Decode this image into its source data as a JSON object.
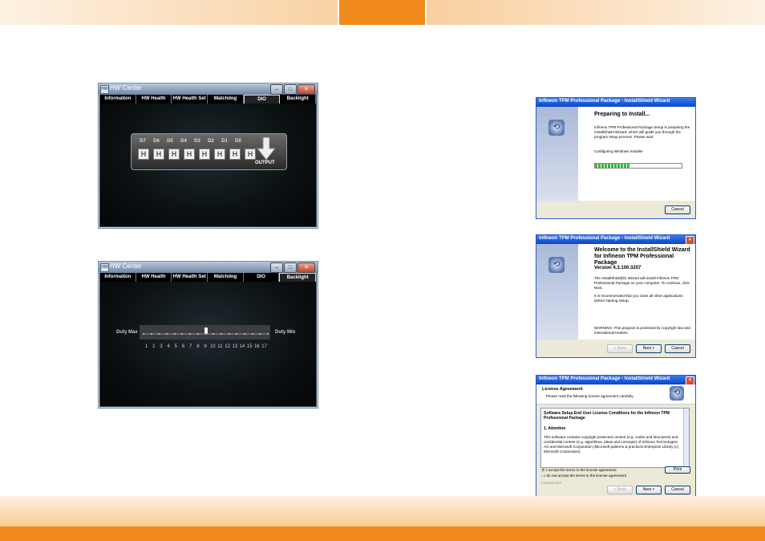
{
  "hw_windows": [
    {
      "title": "HW Center",
      "menu": [
        "Information",
        "HW Health",
        "HW Health Set",
        "Watchdog",
        "DIO",
        "Backlight"
      ],
      "active_tab": "DIO",
      "dio": {
        "labels": [
          "D7",
          "D6",
          "D5",
          "D4",
          "D3",
          "D2",
          "D1",
          "D0"
        ],
        "states": [
          "H",
          "H",
          "H",
          "H",
          "H",
          "H",
          "H",
          "H"
        ],
        "output_label": "OUTPUT"
      }
    },
    {
      "title": "HW Center",
      "menu": [
        "Information",
        "HW Health",
        "HW Health Set",
        "Watchdog",
        "DIO",
        "Backlight"
      ],
      "active_tab": "Backlight",
      "backlight": {
        "left_label": "Duty Max",
        "right_label": "Duty Min",
        "ticks": [
          "1",
          "2",
          "3",
          "4",
          "5",
          "6",
          "7",
          "8",
          "9",
          "10",
          "11",
          "12",
          "13",
          "14",
          "15",
          "16",
          "17"
        ],
        "value": 9
      }
    }
  ],
  "installer": {
    "title": "Infineon TPM Professional Package - InstallShield Wizard",
    "preparing": {
      "heading": "Preparing to Install...",
      "text": "Infineon TPM Professional Package Setup is preparing the InstallShield Wizard, which will guide you through the program setup process. Please wait.",
      "status": "Configuring Windows Installer",
      "progress": 0.4,
      "cancel": "Cancel"
    },
    "welcome": {
      "heading": "Welcome to the InstallShield Wizard for Infineon TPM Professional Package",
      "version": "Version 4.3.100.3207",
      "text1": "The InstallShield(R) Wizard will install Infineon TPM Professional Package on your computer. To continue, click Next.",
      "text2": "It is recommended that you close all other applications before starting Setup.",
      "warning": "WARNING: This program is protected by copyright law and international treaties.",
      "back": "< Back",
      "next": "Next >",
      "cancel": "Cancel"
    },
    "license": {
      "heading": "License Agreement",
      "subheading": "Please read the following license agreement carefully.",
      "doc_title": "Software Setup End User License Conditions for the Infineon TPM Professional Package",
      "section": "1. Attention",
      "body": "This software contains copyright protected content (e.g. codes and structures) and confidential content (e.g. algorithms, ideas and concepts) of Infineon Technologies AG and Microsoft Corporation (Microsoft patterns & practices Enterprise Library (c) Microsoft Corporation).",
      "accept": "I accept the terms in the license agreement",
      "decline": "I do not accept the terms in the license agreement",
      "print": "Print",
      "installshield": "InstallShield",
      "back": "< Back",
      "next": "Next >",
      "cancel": "Cancel"
    }
  }
}
